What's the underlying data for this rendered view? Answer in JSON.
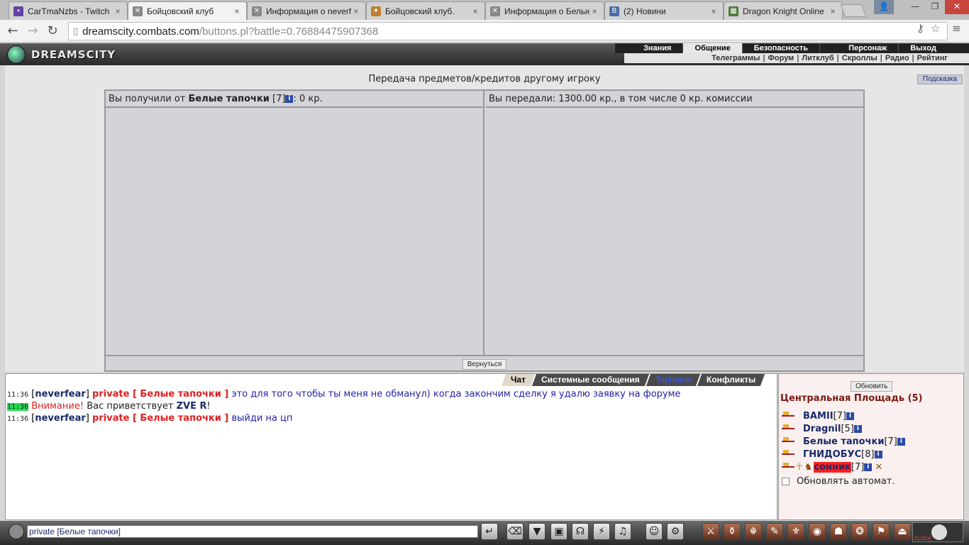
{
  "browser": {
    "tabs": [
      {
        "title": "CarTmaNzbs - Twitch",
        "icon_color": "#6441a5",
        "icon": "twitch-icon"
      },
      {
        "title": "Бойцовский клуб",
        "icon_color": "#888888",
        "icon": "crossed-swords-icon"
      },
      {
        "title": "Информация о neverfear",
        "icon_color": "#888888",
        "icon": "crossed-swords-icon"
      },
      {
        "title": "Бойцовский клуб.",
        "icon_color": "#c08030",
        "icon": "club-icon"
      },
      {
        "title": "Информация о Белые",
        "icon_color": "#888888",
        "icon": "crossed-swords-icon"
      },
      {
        "title": "(2) Новини",
        "icon_color": "#4a6ea8",
        "icon": "vk-icon"
      },
      {
        "title": "Dragon Knight Online",
        "icon_color": "#4a7a3a",
        "icon": "game-icon"
      }
    ],
    "url_host": "dreamscity.combats.com",
    "url_path": "/buttons.pl?battle=0.76884475907368"
  },
  "game": {
    "logo": "DREAMSCITY",
    "menu": [
      "Знания",
      "Общение",
      "Безопасность",
      "Персонаж",
      "Выход"
    ],
    "submenu": [
      "Телеграммы",
      "Форум",
      "Литклуб",
      "Скроллы",
      "Радио",
      "Рейтинг"
    ]
  },
  "trade": {
    "title": "Передача предметов/кредитов другому игроку",
    "hint": "Подсказка",
    "left_prefix": "Вы получили от",
    "left_name": "Белые тапочки",
    "left_level": "[7]",
    "left_suffix": ": 0 кр.",
    "right_text": "Вы передали: 1300.00 кр., в том числе 0 кр. комиссии",
    "back_button": "Вернуться"
  },
  "chat": {
    "tabs": [
      "Чат",
      "Системные сообщения",
      "Торговля",
      "Конфликты"
    ],
    "messages": [
      {
        "time": "11:36",
        "nick": "neverfear",
        "private": "private [ Белые тапочки ]",
        "text": "это для того чтобы ты меня не обманул) когда закончим сделку я удалю заявку на форуме"
      },
      {
        "time": "11:36",
        "warn": "Внимание!",
        "plain": "Вас приветствует",
        "who": "ZVE R",
        "end": "!"
      },
      {
        "time": "11:36",
        "nick": "neverfear",
        "private": "private [ Белые тапочки ]",
        "text": "выйди на цп"
      }
    ],
    "input_value": "private [Белые тапочки]"
  },
  "side": {
    "refresh": "Обновить",
    "room": "Центральная Площадь (5)",
    "users": [
      {
        "name": "BAMII",
        "level": "[7]"
      },
      {
        "name": "Dragnil",
        "level": "[5]"
      },
      {
        "name": "Белые тапочки",
        "level": "[7]"
      },
      {
        "name": "ГНИДОБУС",
        "level": "[8]"
      },
      {
        "name": "сонник",
        "level": "[7]"
      }
    ],
    "auto_refresh": "Обновлять автомат."
  }
}
